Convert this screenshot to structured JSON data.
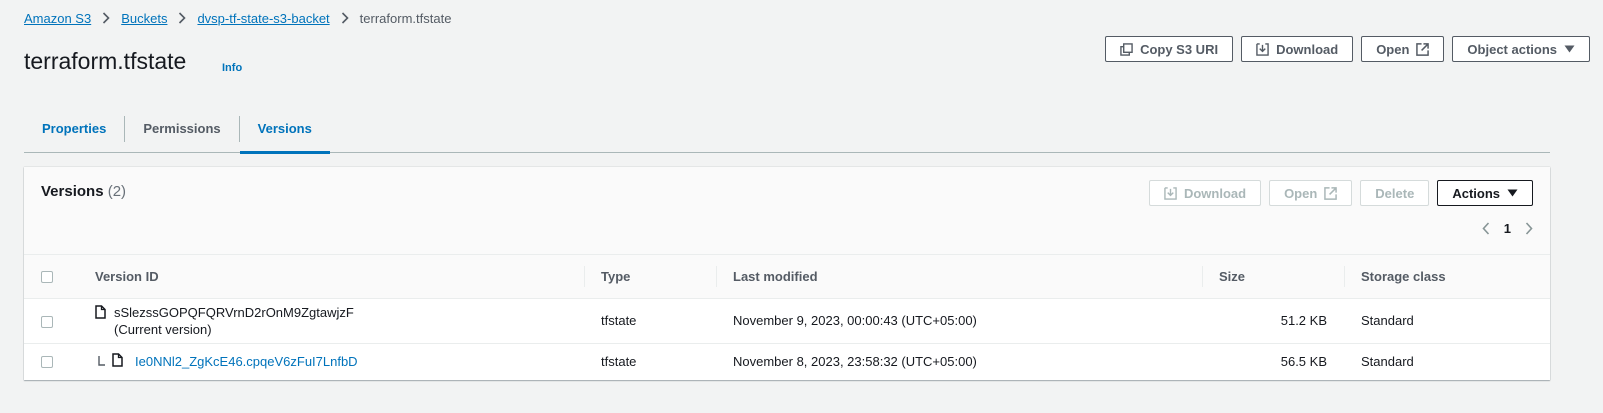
{
  "breadcrumb": {
    "items": [
      "Amazon S3",
      "Buckets",
      "dvsp-tf-state-s3-backet"
    ],
    "current": "terraform.tfstate"
  },
  "header": {
    "title": "terraform.tfstate",
    "info": "Info",
    "buttons": {
      "copy_uri": "Copy S3 URI",
      "download": "Download",
      "open": "Open",
      "object_actions": "Object actions"
    }
  },
  "tabs": [
    "Properties",
    "Permissions",
    "Versions"
  ],
  "versions": {
    "title": "Versions",
    "count": "(2)",
    "buttons": {
      "download": "Download",
      "open": "Open",
      "delete": "Delete",
      "actions": "Actions"
    },
    "page": "1",
    "columns": [
      "Version ID",
      "Type",
      "Last modified",
      "Size",
      "Storage class"
    ],
    "rows": [
      {
        "version_id": "sSlezssGOPQFQRVrnD2rOnM9ZgtawjzF",
        "note": "(Current version)",
        "type": "tfstate",
        "last_modified": "November 9, 2023, 00:00:43 (UTC+05:00)",
        "size": "51.2 KB",
        "storage_class": "Standard"
      },
      {
        "version_id": "Ie0NNl2_ZgKcE46.cpqeV6zFuI7LnfbD",
        "type": "tfstate",
        "last_modified": "November 8, 2023, 23:58:32 (UTC+05:00)",
        "size": "56.5 KB",
        "storage_class": "Standard"
      }
    ]
  },
  "colors": {
    "link": "#0073bb",
    "background": "#f2f3f3",
    "border_dark": "#545b64",
    "disabled": "#aab7b8"
  },
  "icons": [
    "chevron-right-icon",
    "copy-icon",
    "download-icon",
    "external-link-icon",
    "caret-down-icon",
    "chevron-left-icon",
    "file-icon"
  ]
}
